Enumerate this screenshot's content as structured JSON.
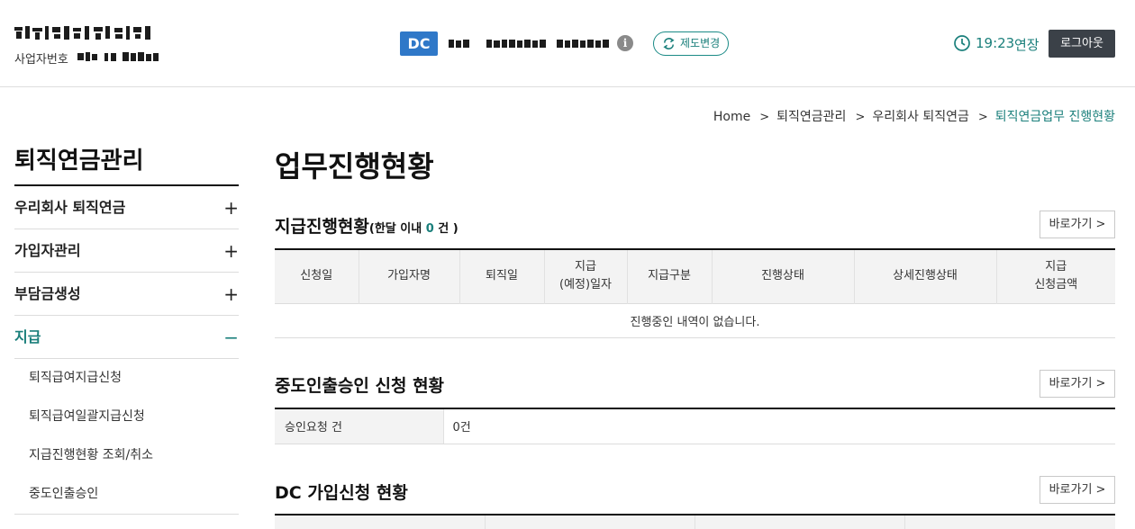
{
  "header": {
    "company_name": "",
    "biz_number_label": "사업자번호",
    "biz_number": "",
    "plan_badge": "DC",
    "plan_name": "",
    "info_icon": "i",
    "change_button": "제도변경",
    "session_time": "19:23",
    "extend_label": "연장",
    "logout_button": "로그아웃",
    "icons": {
      "info": "info-icon",
      "change": "swap-arrows-icon",
      "clock": "clock-icon"
    }
  },
  "breadcrumb": [
    "Home",
    "퇴직연금관리",
    "우리회사 퇴직연금",
    "퇴직연금업무 진행현황"
  ],
  "sidebar": {
    "title": "퇴직연금관리",
    "items": [
      {
        "label": "우리회사 퇴직연금",
        "toggle": "+"
      },
      {
        "label": "가입자관리",
        "toggle": "+"
      },
      {
        "label": "부담금생성",
        "toggle": "+"
      },
      {
        "label": "지급",
        "toggle": "−"
      }
    ],
    "sub_items": [
      "퇴직급여지급신청",
      "퇴직급여일괄지급신청",
      "지급진행현황 조회/취소",
      "중도인출승인"
    ]
  },
  "main": {
    "page_title": "업무진행현황",
    "go_button": "바로가기 >",
    "section1": {
      "title": "지급진행현황",
      "sub_prefix": "(한달 이내 ",
      "count": "0",
      "sub_suffix": " 건 )",
      "columns": [
        "신청일",
        "가입자명",
        "퇴직일",
        "지급\n(예정)일자",
        "지급구분",
        "진행상태",
        "상세진행상태",
        "지급\n신청금액"
      ],
      "empty_message": "진행중인 내역이 없습니다."
    },
    "section2": {
      "title": "중도인출승인 신청 현황",
      "row_label": "승인요청 건",
      "row_value": "0건"
    },
    "section3": {
      "title": "DC 가입신청 현황"
    }
  },
  "colors": {
    "accent": "#1a7f7b",
    "badge": "#2f78c8",
    "logout_bg": "#3b4148"
  }
}
